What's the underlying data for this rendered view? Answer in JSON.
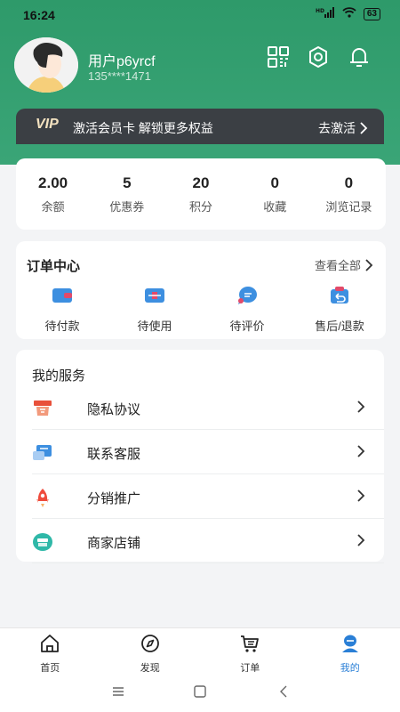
{
  "status": {
    "time": "16:24",
    "battery": "63",
    "signal": "HD"
  },
  "user": {
    "name": "用户p6yrcf",
    "phone": "135****1471"
  },
  "vip": {
    "logo": "VIP",
    "text": "激活会员卡 解锁更多权益",
    "action": "去激活"
  },
  "stats": [
    {
      "value": "2.00",
      "label": "余额"
    },
    {
      "value": "5",
      "label": "优惠券"
    },
    {
      "value": "20",
      "label": "积分"
    },
    {
      "value": "0",
      "label": "收藏"
    },
    {
      "value": "0",
      "label": "浏览记录"
    }
  ],
  "orders": {
    "title": "订单中心",
    "view_all": "查看全部",
    "items": [
      {
        "label": "待付款",
        "icon": "wallet-icon"
      },
      {
        "label": "待使用",
        "icon": "ticket-icon"
      },
      {
        "label": "待评价",
        "icon": "comment-icon"
      },
      {
        "label": "售后/退款",
        "icon": "return-icon"
      }
    ]
  },
  "services": {
    "title": "我的服务",
    "items": [
      {
        "label": "隐私协议",
        "icon": "privacy-icon"
      },
      {
        "label": "联系客服",
        "icon": "chat-icon"
      },
      {
        "label": "分销推广",
        "icon": "rocket-icon"
      },
      {
        "label": "商家店铺",
        "icon": "store-icon"
      }
    ]
  },
  "tabs": [
    {
      "label": "首页",
      "icon": "home-icon"
    },
    {
      "label": "发现",
      "icon": "compass-icon"
    },
    {
      "label": "订单",
      "icon": "cart-icon"
    },
    {
      "label": "我的",
      "icon": "profile-icon"
    }
  ],
  "colors": {
    "header": "#2e9a6a",
    "accent": "#2a7fd6",
    "vip_bg": "#3b3f44"
  }
}
